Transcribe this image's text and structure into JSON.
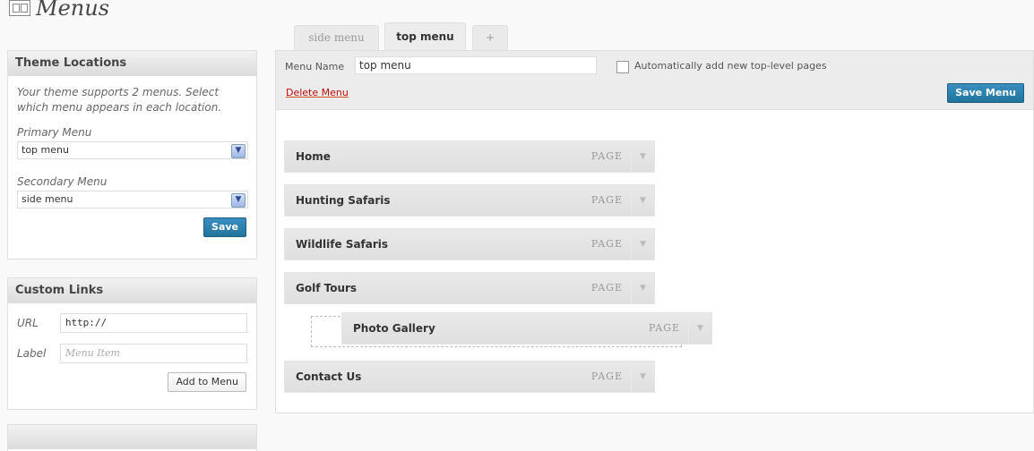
{
  "page": {
    "title": "Menus"
  },
  "theme_locations": {
    "heading": "Theme Locations",
    "note": "Your theme supports 2 menus. Select which menu appears in each location.",
    "primary_label": "Primary Menu",
    "primary_value": "top menu",
    "secondary_label": "Secondary Menu",
    "secondary_value": "side menu",
    "save_label": "Save"
  },
  "custom_links": {
    "heading": "Custom Links",
    "url_label": "URL",
    "url_value": "http://",
    "label_label": "Label",
    "label_placeholder": "Menu Item",
    "add_label": "Add to Menu"
  },
  "tabs": [
    {
      "label": "side menu",
      "active": false
    },
    {
      "label": "top menu",
      "active": true
    },
    {
      "label": "+",
      "active": false
    }
  ],
  "editor": {
    "menu_name_label": "Menu Name",
    "menu_name_value": "top menu",
    "auto_add_label": "Automatically add new top-level pages",
    "auto_add_checked": false,
    "delete_label": "Delete Menu",
    "save_label": "Save Menu"
  },
  "menu_items": [
    {
      "title": "Home",
      "type": "PAGE",
      "depth": 0
    },
    {
      "title": "Hunting Safaris",
      "type": "PAGE",
      "depth": 0
    },
    {
      "title": "Wildlife Safaris",
      "type": "PAGE",
      "depth": 0
    },
    {
      "title": "Golf Tours",
      "type": "PAGE",
      "depth": 0
    },
    {
      "title": "Photo Gallery",
      "type": "PAGE",
      "depth": 1,
      "dragging": true
    },
    {
      "title": "Contact Us",
      "type": "PAGE",
      "depth": 0
    }
  ],
  "colors": {
    "primary_button": "#21759b",
    "delete_link": "#bc0b0b"
  }
}
